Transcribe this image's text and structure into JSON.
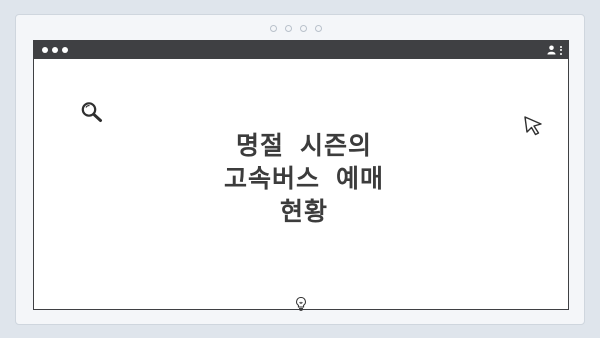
{
  "heading": {
    "line1": "명절 시즌의",
    "line2": "고속버스 예매",
    "line3": "현황"
  },
  "icons": {
    "search": "search-icon",
    "cursor": "cursor-arrow-icon",
    "lightbulb": "lightbulb-icon",
    "user": "user-icon",
    "menu": "kebab-menu-icon"
  },
  "colors": {
    "background": "#dfe5ec",
    "titlebar": "#3f4043",
    "text": "#3c3c3c"
  }
}
